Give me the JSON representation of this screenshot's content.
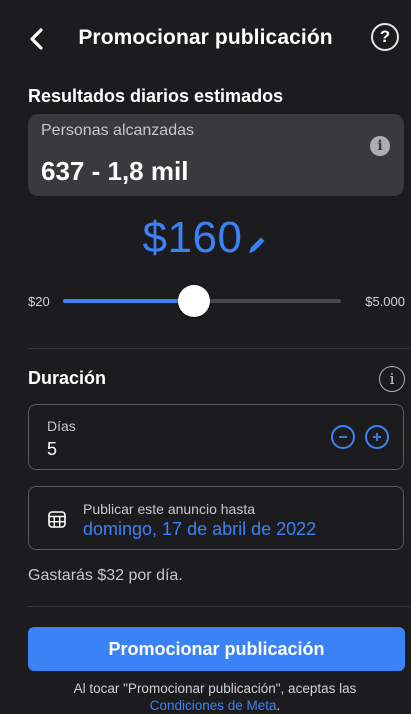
{
  "header": {
    "title": "Promocionar publicación",
    "help_label": "?"
  },
  "results": {
    "section_title": "Resultados diarios estimados",
    "reach_label": "Personas alcanzadas",
    "reach_value": "637 - 1,8 mil",
    "info_label": "i"
  },
  "budget": {
    "amount": "$160",
    "slider_min": "$20",
    "slider_max": "$5.000",
    "slider_position": 0.47
  },
  "duration": {
    "section_title": "Duración",
    "info_label": "i",
    "days_label": "Días",
    "days_value": "5",
    "end_date_label": "Publicar este anuncio hasta",
    "end_date_value": "domingo, 17 de abril de 2022",
    "daily_spend_text": "Gastarás $32 por día."
  },
  "footer": {
    "promote_button_label": "Promocionar publicación",
    "terms_text": "Al tocar \"Promocionar publicación\", aceptas las",
    "terms_link": "Condiciones de Meta",
    "terms_end": "."
  },
  "colors": {
    "background": "#1c1c1e",
    "card": "#3a3a3c",
    "accent": "#3b82f6",
    "text_secondary": "#c7c7cc"
  }
}
